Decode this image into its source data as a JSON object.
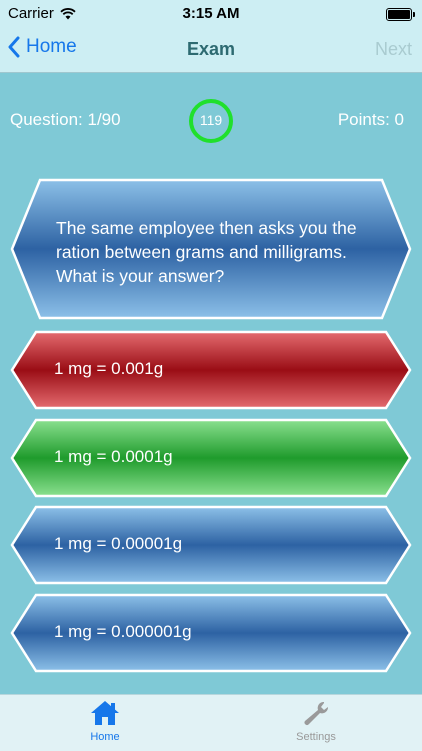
{
  "status": {
    "carrier": "Carrier",
    "time": "3:15 AM"
  },
  "nav": {
    "back_label": "Home",
    "title": "Exam",
    "next_label": "Next"
  },
  "info": {
    "question": "Question: 1/90",
    "points": "Points: 0",
    "timer": "119"
  },
  "question": {
    "text": "The same employee then asks you the ration between grams and milligrams. What is your answer?"
  },
  "answers": [
    {
      "label": "1 mg = 0.001g",
      "state": "wrong"
    },
    {
      "label": "1 mg = 0.0001g",
      "state": "correct"
    },
    {
      "label": "1 mg = 0.00001g",
      "state": "neutral"
    },
    {
      "label": "1 mg = 0.000001g",
      "state": "neutral"
    }
  ],
  "tabs": [
    {
      "label": "Home"
    },
    {
      "label": "Settings"
    }
  ],
  "colors": {
    "wrong": "#a9141c",
    "correct": "#27a234",
    "neutral": "#2f6ea8",
    "accent": "#1677ea"
  }
}
